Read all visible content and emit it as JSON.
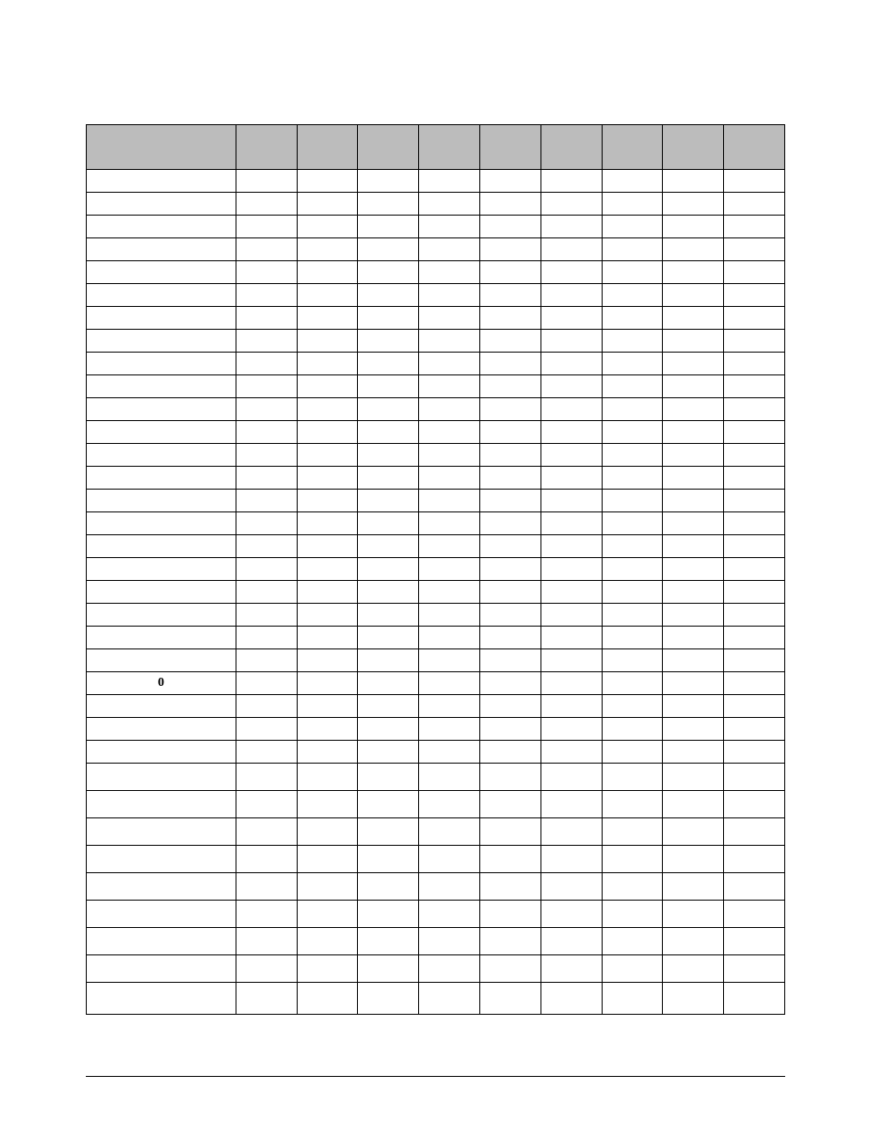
{
  "table": {
    "headers": [
      "",
      "",
      "",
      "",
      "",
      "",
      "",
      "",
      "",
      ""
    ],
    "rows": [
      [
        "",
        "",
        "",
        "",
        "",
        "",
        "",
        "",
        "",
        ""
      ],
      [
        "",
        "",
        "",
        "",
        "",
        "",
        "",
        "",
        "",
        ""
      ],
      [
        "",
        "",
        "",
        "",
        "",
        "",
        "",
        "",
        "",
        ""
      ],
      [
        "",
        "",
        "",
        "",
        "",
        "",
        "",
        "",
        "",
        ""
      ],
      [
        "",
        "",
        "",
        "",
        "",
        "",
        "",
        "",
        "",
        ""
      ],
      [
        "",
        "",
        "",
        "",
        "",
        "",
        "",
        "",
        "",
        ""
      ],
      [
        "",
        "",
        "",
        "",
        "",
        "",
        "",
        "",
        "",
        ""
      ],
      [
        "",
        "",
        "",
        "",
        "",
        "",
        "",
        "",
        "",
        ""
      ],
      [
        "",
        "",
        "",
        "",
        "",
        "",
        "",
        "",
        "",
        ""
      ],
      [
        "",
        "",
        "",
        "",
        "",
        "",
        "",
        "",
        "",
        ""
      ],
      [
        "",
        "",
        "",
        "",
        "",
        "",
        "",
        "",
        "",
        ""
      ],
      [
        "",
        "",
        "",
        "",
        "",
        "",
        "",
        "",
        "",
        ""
      ],
      [
        "",
        "",
        "",
        "",
        "",
        "",
        "",
        "",
        "",
        ""
      ],
      [
        "",
        "",
        "",
        "",
        "",
        "",
        "",
        "",
        "",
        ""
      ],
      [
        "",
        "",
        "",
        "",
        "",
        "",
        "",
        "",
        "",
        ""
      ],
      [
        "",
        "",
        "",
        "",
        "",
        "",
        "",
        "",
        "",
        ""
      ],
      [
        "",
        "",
        "",
        "",
        "",
        "",
        "",
        "",
        "",
        ""
      ],
      [
        "",
        "",
        "",
        "",
        "",
        "",
        "",
        "",
        "",
        ""
      ],
      [
        "",
        "",
        "",
        "",
        "",
        "",
        "",
        "",
        "",
        ""
      ],
      [
        "",
        "",
        "",
        "",
        "",
        "",
        "",
        "",
        "",
        ""
      ],
      [
        "",
        "",
        "",
        "",
        "",
        "",
        "",
        "",
        "",
        ""
      ],
      [
        "",
        "",
        "",
        "",
        "",
        "",
        "",
        "",
        "",
        ""
      ],
      [
        "0",
        "",
        "",
        "",
        "",
        "",
        "",
        "",
        "",
        ""
      ],
      [
        "",
        "",
        "",
        "",
        "",
        "",
        "",
        "",
        "",
        ""
      ],
      [
        "",
        "",
        "",
        "",
        "",
        "",
        "",
        "",
        "",
        ""
      ],
      [
        "",
        "",
        "",
        "",
        "",
        "",
        "",
        "",
        "",
        ""
      ],
      [
        "",
        "",
        "",
        "",
        "",
        "",
        "",
        "",
        "",
        ""
      ],
      [
        "",
        "",
        "",
        "",
        "",
        "",
        "",
        "",
        "",
        ""
      ],
      [
        "",
        "",
        "",
        "",
        "",
        "",
        "",
        "",
        "",
        ""
      ],
      [
        "",
        "",
        "",
        "",
        "",
        "",
        "",
        "",
        "",
        ""
      ],
      [
        "",
        "",
        "",
        "",
        "",
        "",
        "",
        "",
        "",
        ""
      ],
      [
        "",
        "",
        "",
        "",
        "",
        "",
        "",
        "",
        "",
        ""
      ],
      [
        "",
        "",
        "",
        "",
        "",
        "",
        "",
        "",
        "",
        ""
      ],
      [
        "",
        "",
        "",
        "",
        "",
        "",
        "",
        "",
        "",
        ""
      ],
      [
        "",
        "",
        "",
        "",
        "",
        "",
        "",
        "",
        "",
        ""
      ]
    ],
    "tall_rows": [
      26,
      27,
      28,
      29,
      30,
      31,
      32,
      33,
      34
    ],
    "xtall_row": 34
  }
}
